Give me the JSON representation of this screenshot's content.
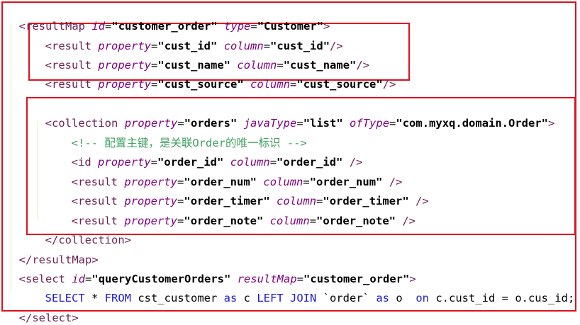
{
  "code": {
    "l1": {
      "open": "<",
      "tag": "resultMap",
      "a1": "id",
      "v1": "\"customer_order\"",
      "a2": "type",
      "v2": "\"Customer\"",
      "close": ">"
    },
    "l2": {
      "open": "<",
      "tag": "result",
      "a1": "property",
      "v1": "\"cust_id\"",
      "a2": "column",
      "v2": "\"cust_id\"",
      "close": "/>"
    },
    "l3": {
      "open": "<",
      "tag": "result",
      "a1": "property",
      "v1": "\"cust_name\"",
      "a2": "column",
      "v2": "\"cust_name\"",
      "close": "/>"
    },
    "l4": {
      "open": "<",
      "tag": "result",
      "a1": "property",
      "v1": "\"cust_source\"",
      "a2": "column",
      "v2": "\"cust_source\"",
      "close": "/>"
    },
    "l6": {
      "open": "<",
      "tag": "collection",
      "a1": "property",
      "v1": "\"orders\"",
      "a2": "javaType",
      "v2": "\"list\"",
      "a3": "ofType",
      "v3": "\"com.myxq.domain.Order\"",
      "close": ">"
    },
    "l7": {
      "comment": "<!-- 配置主键，是关联Order的唯一标识 -->"
    },
    "l8": {
      "open": "<",
      "tag": "id",
      "a1": "property",
      "v1": "\"order_id\"",
      "a2": "column",
      "v2": "\"order_id\"",
      "close": " />"
    },
    "l9": {
      "open": "<",
      "tag": "result",
      "a1": "property",
      "v1": "\"order_num\"",
      "a2": "column",
      "v2": "\"order_num\"",
      "close": " />"
    },
    "l10": {
      "open": "<",
      "tag": "result",
      "a1": "property",
      "v1": "\"order_timer\"",
      "a2": "column",
      "v2": "\"order_timer\"",
      "close": " />"
    },
    "l11": {
      "open": "<",
      "tag": "result",
      "a1": "property",
      "v1": "\"order_note\"",
      "a2": "column",
      "v2": "\"order_note\"",
      "close": " />"
    },
    "l12": {
      "text": "</collection>"
    },
    "l13": {
      "text": "</resultMap>"
    },
    "l14": {
      "open": "<",
      "tag": "select",
      "a1": "id",
      "v1": "\"queryCustomerOrders\"",
      "a2": "resultMap",
      "v2": "\"customer_order\"",
      "close": ">"
    },
    "l15": {
      "k1": "SELECT",
      "s1": " * ",
      "k2": "FROM",
      "s2": " cst_customer ",
      "k3": "as",
      "s3": " c ",
      "k4": "LEFT JOIN",
      "s4": " `order` ",
      "k5": "as",
      "s5": " o  ",
      "k6": "on",
      "s6": " c.cust_id = o.cus_id;"
    },
    "l16": {
      "text": "</select>"
    }
  },
  "colors": {
    "highlight_border": "#e0101c",
    "tag": "#6e1f52",
    "attribute": "#7f007f",
    "comment": "#3f9f5f",
    "sql_keyword": "#1c1ccc"
  }
}
